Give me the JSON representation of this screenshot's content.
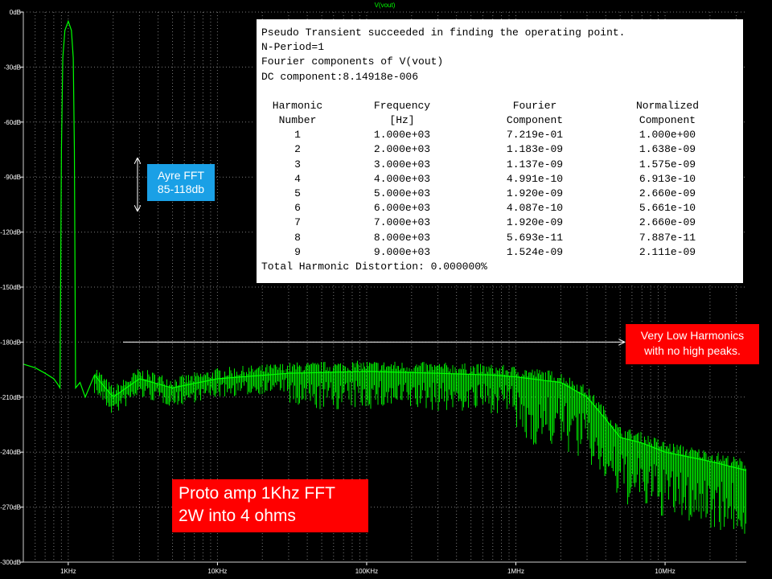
{
  "chart_data": {
    "type": "line",
    "trace_label": "V(vout)",
    "xscale": "log",
    "xlim": [
      500,
      35000000
    ],
    "ylim": [
      -300,
      0
    ],
    "x_ticks": [
      {
        "value": 1000,
        "label": "1KHz"
      },
      {
        "value": 10000,
        "label": "10KHz"
      },
      {
        "value": 100000,
        "label": "100KHz"
      },
      {
        "value": 1000000,
        "label": "1MHz"
      },
      {
        "value": 10000000,
        "label": "10MHz"
      }
    ],
    "y_ticks": [
      {
        "value": 0,
        "label": "0dB"
      },
      {
        "value": -30,
        "label": "-30dB"
      },
      {
        "value": -60,
        "label": "-60dB"
      },
      {
        "value": -90,
        "label": "-90dB"
      },
      {
        "value": -120,
        "label": "-120dB"
      },
      {
        "value": -150,
        "label": "-150dB"
      },
      {
        "value": -180,
        "label": "-180dB"
      },
      {
        "value": -210,
        "label": "-210dB"
      },
      {
        "value": -240,
        "label": "-240dB"
      },
      {
        "value": -270,
        "label": "-270dB"
      },
      {
        "value": -300,
        "label": "-300dB"
      }
    ],
    "grid": true,
    "series": [
      {
        "color": "#00ff00",
        "points": [
          [
            500,
            -192
          ],
          [
            600,
            -194
          ],
          [
            700,
            -197
          ],
          [
            800,
            -200
          ],
          [
            850,
            -203
          ],
          [
            880,
            -205
          ],
          [
            900,
            -75
          ],
          [
            920,
            -25
          ],
          [
            950,
            -10
          ],
          [
            1000,
            -5
          ],
          [
            1050,
            -10
          ],
          [
            1080,
            -25
          ],
          [
            1100,
            -75
          ],
          [
            1120,
            -205
          ],
          [
            1200,
            -202
          ],
          [
            1300,
            -210
          ],
          [
            1500,
            -198
          ],
          [
            2000,
            -210
          ],
          [
            3000,
            -200
          ],
          [
            5000,
            -205
          ],
          [
            10000,
            -200
          ],
          [
            30000,
            -197
          ],
          [
            100000,
            -196
          ],
          [
            300000,
            -197
          ],
          [
            700000,
            -198
          ],
          [
            1000000,
            -199
          ],
          [
            2000000,
            -202
          ],
          [
            3000000,
            -210
          ],
          [
            4000000,
            -222
          ],
          [
            5000000,
            -232
          ],
          [
            7000000,
            -235
          ],
          [
            10000000,
            -240
          ],
          [
            20000000,
            -245
          ],
          [
            35000000,
            -250
          ]
        ]
      }
    ]
  },
  "fourier_log": {
    "header_lines": [
      "Pseudo Transient succeeded in finding the operating point.",
      "N-Period=1",
      "Fourier components of V(vout)",
      "DC component:8.14918e-006"
    ],
    "columns": [
      {
        "line1": "Harmonic",
        "line2": "Number"
      },
      {
        "line1": "Frequency",
        "line2": "[Hz]"
      },
      {
        "line1": "Fourier",
        "line2": "Component"
      },
      {
        "line1": "Normalized",
        "line2": "Component"
      }
    ],
    "rows": [
      [
        "1",
        "1.000e+03",
        "7.219e-01",
        "1.000e+00"
      ],
      [
        "2",
        "2.000e+03",
        "1.183e-09",
        "1.638e-09"
      ],
      [
        "3",
        "3.000e+03",
        "1.137e-09",
        "1.575e-09"
      ],
      [
        "4",
        "4.000e+03",
        "4.991e-10",
        "6.913e-10"
      ],
      [
        "5",
        "5.000e+03",
        "1.920e-09",
        "2.660e-09"
      ],
      [
        "6",
        "6.000e+03",
        "4.087e-10",
        "5.661e-10"
      ],
      [
        "7",
        "7.000e+03",
        "1.920e-09",
        "2.660e-09"
      ],
      [
        "8",
        "8.000e+03",
        "5.693e-11",
        "7.887e-11"
      ],
      [
        "9",
        "9.000e+03",
        "1.524e-09",
        "2.111e-09"
      ]
    ],
    "footer": "Total Harmonic Distortion: 0.000000%"
  },
  "annotations": {
    "ayre_line1": "Ayre FFT",
    "ayre_line2": "85-118db",
    "harmonics_line1": "Very Low Harmonics",
    "harmonics_line2": "with no high peaks.",
    "proto_line1": "Proto amp 1Khz FFT",
    "proto_line2": "2W into 4 ohms"
  },
  "colors": {
    "background": "#000000",
    "trace": "#00ff00",
    "grid": "#7a7a7a",
    "axis_text": "#ffffff",
    "callout_blue": "#1aa0e6",
    "callout_red": "#ff0000"
  }
}
